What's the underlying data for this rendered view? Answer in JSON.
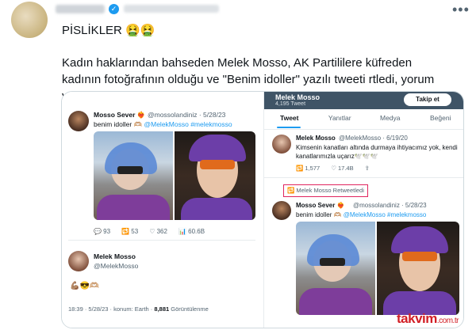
{
  "tweet": {
    "verified_badge": "✓",
    "more_icon": "•••",
    "title": "PİSLİKLER 🤮🤮",
    "body": "Kadın haklarından bahseden Melek Mosso, AK Partililere küfreden kadının fotoğrafının olduğu ve \"Benim idoller\" yazılı tweeti rtledi, yorum yaptı."
  },
  "left_screenshot": {
    "author_name": "Mosso Sever ❤️‍🔥",
    "author_handle": "@mossolandiniz · 5/28/23",
    "text": "benim idoller 🫶🏼 ",
    "tags": "@MelekMosso #melekmosso",
    "actions": {
      "replies": "💬 93",
      "retweets": "🔁 53",
      "likes": "♡ 362",
      "views": "📊 60.6B"
    },
    "reply_author": "Melek Mosso",
    "reply_handle": "@MelekMosso",
    "reply_emoji": "💪🏽😎🫶🏼",
    "meta_time": "18:39 · 5/28/23 · konum: Earth · ",
    "meta_views": "8,881",
    "meta_views_label": " Görüntülenme"
  },
  "right_screenshot": {
    "header_name": "Melek Mosso",
    "header_count": "4,195 Tweet",
    "follow_button": "Takip et",
    "tabs": [
      "Tweet",
      "Yanıtlar",
      "Medya",
      "Beğeni"
    ],
    "tweet1_name": "Melek Mosso",
    "tweet1_handle": "@MelekMosso · 6/19/20",
    "tweet1_text": "Kimsenin kanatları altında durmaya ihtiyacımız yok, kendi kanatlarımızla uçarız🕊️🕊️🕊️",
    "tweet1_actions": {
      "retweets": "🔁 1,577",
      "likes": "♡ 17.4B",
      "share": "⇪"
    },
    "retweet_label": "🔁 Melek Mosso Retweetledi",
    "tweet2_name": "Mosso Sever ❤️‍🔥",
    "tweet2_handle": "@mossolandiniz · 5/28/23",
    "tweet2_text": "benim idoller 🫶🏼 ",
    "tweet2_tags": "@MelekMosso #melekmosso"
  },
  "watermark": {
    "brand": "takvim",
    "suffix": ".com.tr"
  },
  "colors": {
    "accent": "#1d9bf0",
    "highlight_border": "#e0245e",
    "watermark": "#d21f26"
  }
}
